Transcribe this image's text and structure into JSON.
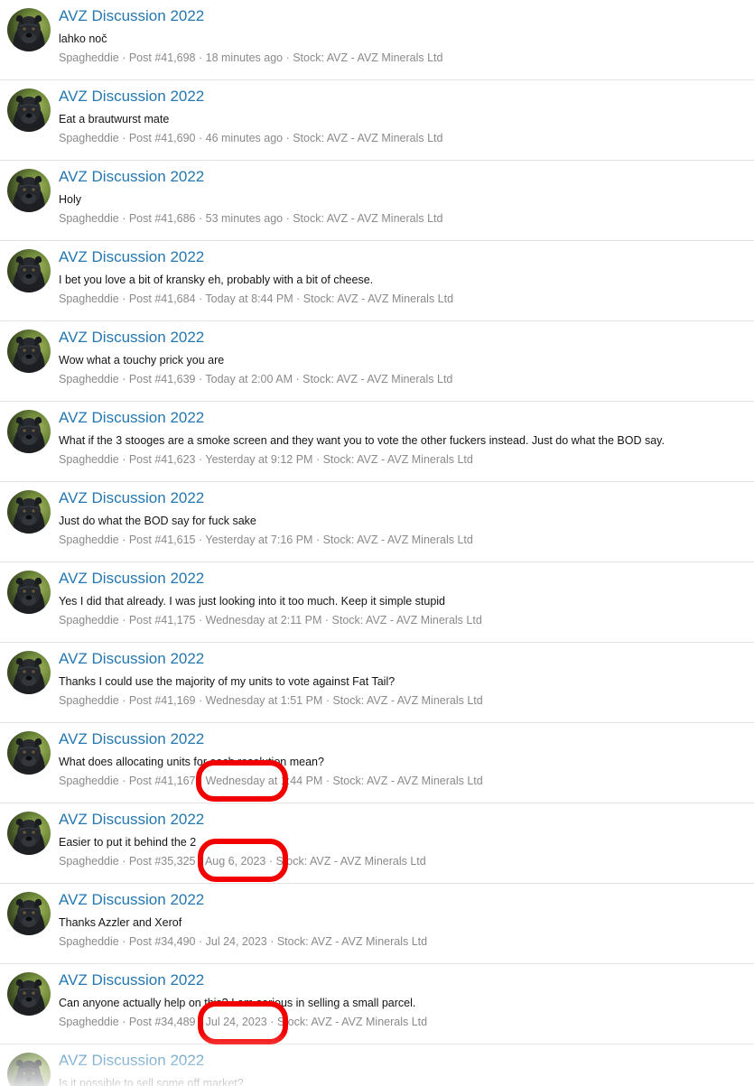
{
  "posts": [
    {
      "title": "AVZ Discussion 2022",
      "body": "lahko noč",
      "author": "Spagheddie",
      "post": "Post #41,698",
      "time": "18 minutes ago",
      "stock": "Stock: AVZ - AVZ Minerals Ltd"
    },
    {
      "title": "AVZ Discussion 2022",
      "body": "Eat a brautwurst mate",
      "author": "Spagheddie",
      "post": "Post #41,690",
      "time": "46 minutes ago",
      "stock": "Stock: AVZ - AVZ Minerals Ltd"
    },
    {
      "title": "AVZ Discussion 2022",
      "body": "Holy",
      "author": "Spagheddie",
      "post": "Post #41,686",
      "time": "53 minutes ago",
      "stock": "Stock: AVZ - AVZ Minerals Ltd"
    },
    {
      "title": "AVZ Discussion 2022",
      "body": "I bet you love a bit of kransky eh, probably with a bit of cheese.",
      "author": "Spagheddie",
      "post": "Post #41,684",
      "time": "Today at 8:44 PM",
      "stock": "Stock: AVZ - AVZ Minerals Ltd"
    },
    {
      "title": "AVZ Discussion 2022",
      "body": "Wow what a touchy prick you are",
      "author": "Spagheddie",
      "post": "Post #41,639",
      "time": "Today at 2:00 AM",
      "stock": "Stock: AVZ - AVZ Minerals Ltd"
    },
    {
      "title": "AVZ Discussion 2022",
      "body": "What if the 3 stooges are a smoke screen and they want you to vote the other fuckers instead. Just do what the BOD say.",
      "author": "Spagheddie",
      "post": "Post #41,623",
      "time": "Yesterday at 9:12 PM",
      "stock": "Stock: AVZ - AVZ Minerals Ltd"
    },
    {
      "title": "AVZ Discussion 2022",
      "body": "Just do what the BOD say for fuck sake",
      "author": "Spagheddie",
      "post": "Post #41,615",
      "time": "Yesterday at 7:16 PM",
      "stock": "Stock: AVZ - AVZ Minerals Ltd"
    },
    {
      "title": "AVZ Discussion 2022",
      "body": "Yes I did that already. I was just looking into it too much. Keep it simple stupid",
      "author": "Spagheddie",
      "post": "Post #41,175",
      "time": "Wednesday at 2:11 PM",
      "stock": "Stock: AVZ - AVZ Minerals Ltd"
    },
    {
      "title": "AVZ Discussion 2022",
      "body": "Thanks I could use the majority of my units to vote against Fat Tail?",
      "author": "Spagheddie",
      "post": "Post #41,169",
      "time": "Wednesday at 1:51 PM",
      "stock": "Stock: AVZ - AVZ Minerals Ltd"
    },
    {
      "title": "AVZ Discussion 2022",
      "body": "What does allocating units for each resolution mean?",
      "author": "Spagheddie",
      "post": "Post #41,167",
      "time": "Wednesday at 1:44 PM",
      "stock": "Stock: AVZ - AVZ Minerals Ltd"
    },
    {
      "title": "AVZ Discussion 2022",
      "body": "Easier to put it behind the 2",
      "author": "Spagheddie",
      "post": "Post #35,325",
      "time": "Aug 6, 2023",
      "stock": "Stock: AVZ - AVZ Minerals Ltd"
    },
    {
      "title": "AVZ Discussion 2022",
      "body": "Thanks Azzler and Xerof",
      "author": "Spagheddie",
      "post": "Post #34,490",
      "time": "Jul 24, 2023",
      "stock": "Stock: AVZ - AVZ Minerals Ltd"
    },
    {
      "title": "AVZ Discussion 2022",
      "body": "Can anyone actually help on this? I am serious in selling a small parcel.",
      "author": "Spagheddie",
      "post": "Post #34,489",
      "time": "Jul 24, 2023",
      "stock": "Stock: AVZ - AVZ Minerals Ltd"
    },
    {
      "title": "AVZ Discussion 2022",
      "body": "Is it possible to sell some off market?",
      "author": "",
      "post": "",
      "time": "",
      "stock": ""
    }
  ],
  "separator": " · ",
  "highlight_color": "#f20000",
  "highlighted_timestamps": [
    9,
    10,
    12
  ]
}
